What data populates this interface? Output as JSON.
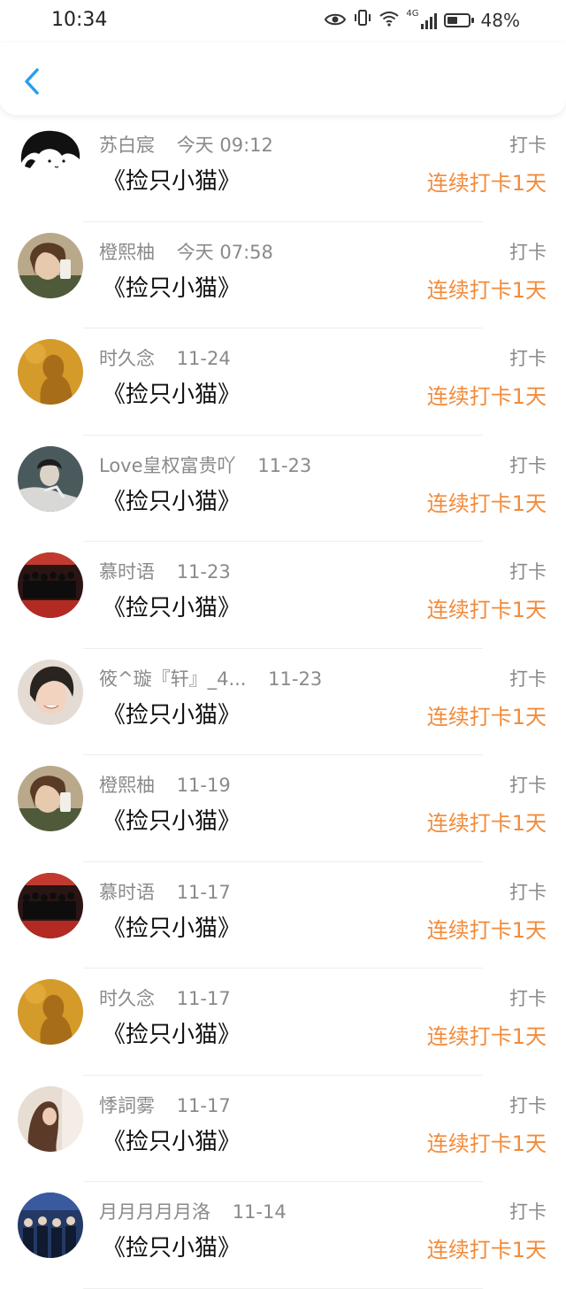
{
  "status_bar": {
    "time": "10:34",
    "network": "4G",
    "battery": "48%",
    "battery_level": 0.48
  },
  "header": {
    "back_icon": "chevron-left-icon"
  },
  "colors": {
    "accent": "#2a9fe9",
    "streak": "#f28b3b",
    "meta_text": "#8a8a8a"
  },
  "records": [
    {
      "name": "苏白宸",
      "time": "今天 09:12",
      "title": "《捡只小猫》",
      "action": "打卡",
      "streak": "连续打卡1天",
      "avatar": "cartoon"
    },
    {
      "name": "橙熙柚",
      "time": "今天 07:58",
      "title": "《捡只小猫》",
      "action": "打卡",
      "streak": "连续打卡1天",
      "avatar": "selfie"
    },
    {
      "name": "时久念",
      "time": "11-24",
      "title": "《捡只小猫》",
      "action": "打卡",
      "streak": "连续打卡1天",
      "avatar": "silhouette"
    },
    {
      "name": "Love皇权富贵吖",
      "time": "11-23",
      "title": "《捡只小猫》",
      "action": "打卡",
      "streak": "连续打卡1天",
      "avatar": "mono-photo"
    },
    {
      "name": "慕时语",
      "time": "11-23",
      "title": "《捡只小猫》",
      "action": "打卡",
      "streak": "连续打卡1天",
      "avatar": "group-stage"
    },
    {
      "name": "筱^璇『轩』_4...",
      "time": "11-23",
      "title": "《捡只小猫》",
      "action": "打卡",
      "streak": "连续打卡1天",
      "avatar": "portrait"
    },
    {
      "name": "橙熙柚",
      "time": "11-19",
      "title": "《捡只小猫》",
      "action": "打卡",
      "streak": "连续打卡1天",
      "avatar": "selfie"
    },
    {
      "name": "慕时语",
      "time": "11-17",
      "title": "《捡只小猫》",
      "action": "打卡",
      "streak": "连续打卡1天",
      "avatar": "group-stage"
    },
    {
      "name": "时久念",
      "time": "11-17",
      "title": "《捡只小猫》",
      "action": "打卡",
      "streak": "连续打卡1天",
      "avatar": "silhouette"
    },
    {
      "name": "悸詞雾",
      "time": "11-17",
      "title": "《捡只小猫》",
      "action": "打卡",
      "streak": "连续打卡1天",
      "avatar": "long-hair"
    },
    {
      "name": "月月月月月洛",
      "time": "11-14",
      "title": "《捡只小猫》",
      "action": "打卡",
      "streak": "连续打卡1天",
      "avatar": "group-blue"
    }
  ]
}
